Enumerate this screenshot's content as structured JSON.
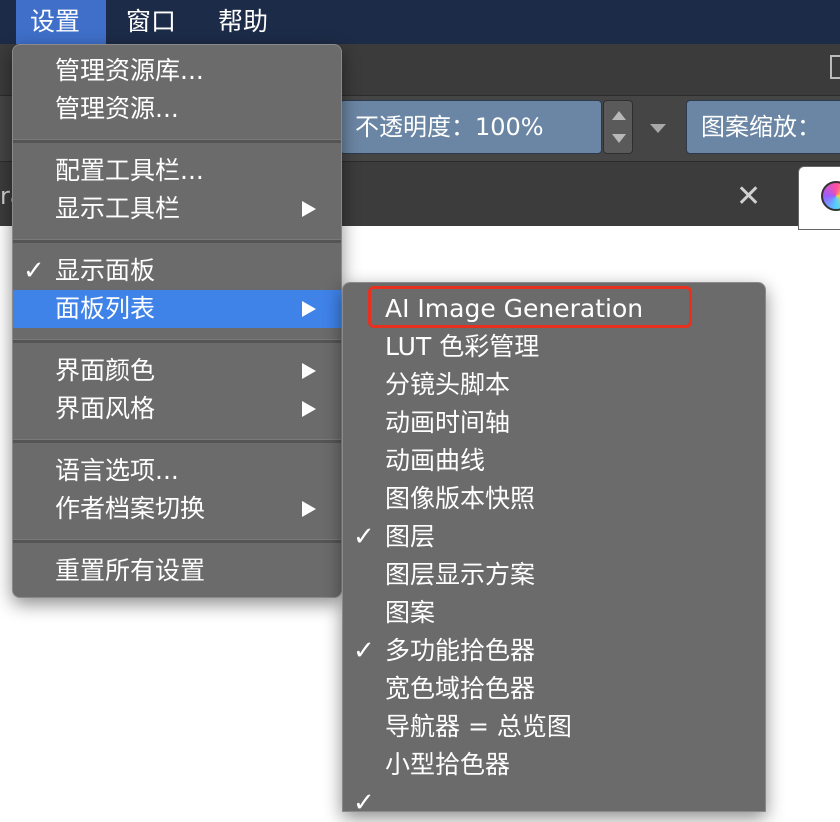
{
  "menubar": {
    "items": [
      "设置",
      "窗口",
      "帮助"
    ]
  },
  "toolbar": {
    "opacity_label": "不透明度：",
    "opacity_value": "100%",
    "pattern_zoom_label": "图案缩放："
  },
  "tab_fragment": "ra",
  "settings_menu": {
    "manage_bundles": "管理资源库...",
    "manage_resources": "管理资源...",
    "configure_toolbars": "配置工具栏...",
    "show_toolbars": "显示工具栏",
    "show_dockers": "显示面板",
    "dockers_list": "面板列表",
    "ui_color": "界面颜色",
    "ui_style": "界面风格",
    "language": "语言选项...",
    "switch_profile": "作者档案切换",
    "reset_all": "重置所有设置"
  },
  "dockers_submenu": {
    "items": [
      "AI Image Generation",
      "LUT 色彩管理",
      "分镜头脚本",
      "动画时间轴",
      "动画曲线",
      "图像版本快照",
      "图层",
      "图层显示方案",
      "图案",
      "多功能拾色器",
      "宽色域拾色器",
      "导航器 = 总览图",
      "小型拾色器"
    ]
  },
  "icons": {
    "check": "✓"
  }
}
